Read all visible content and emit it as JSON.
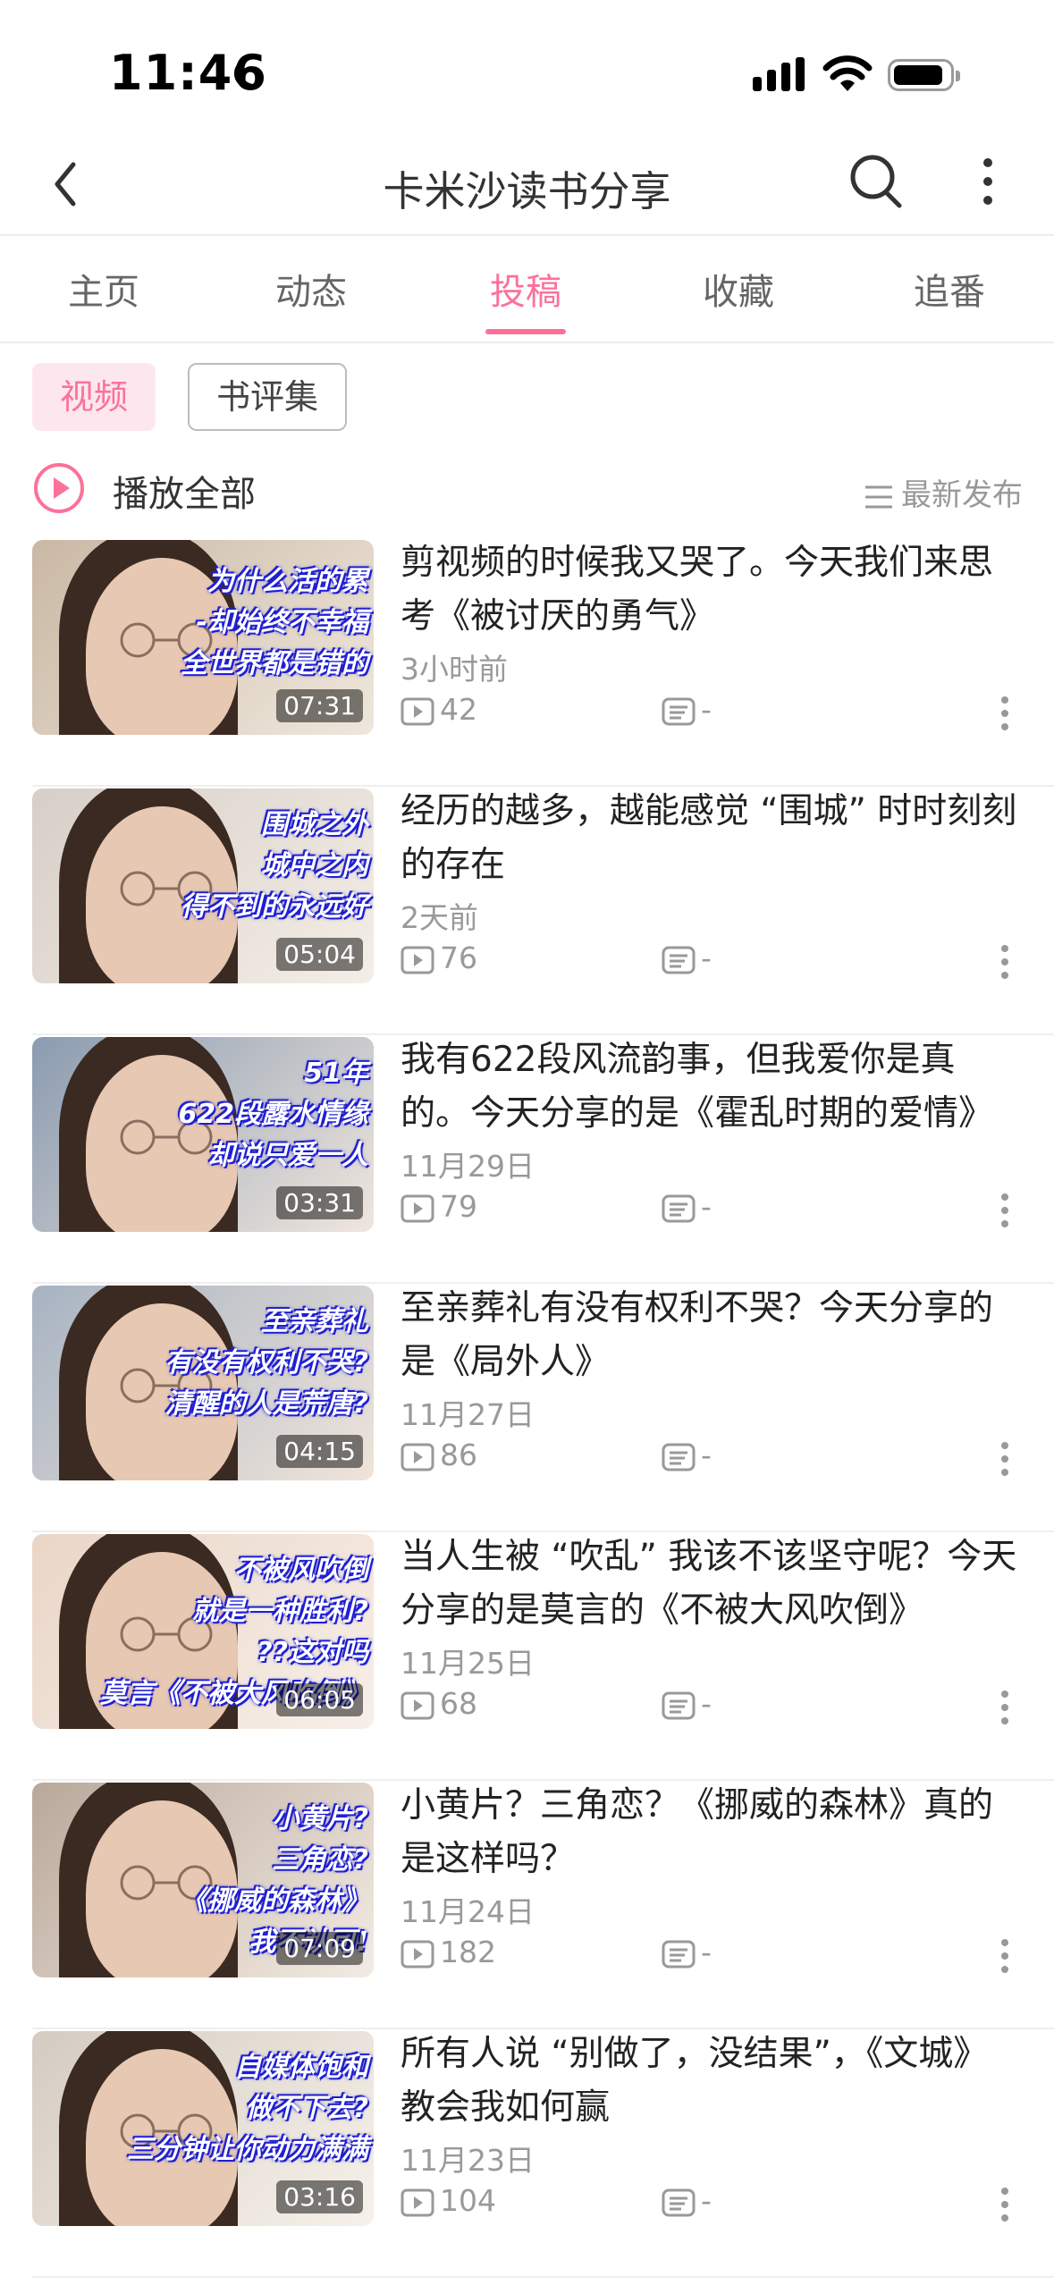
{
  "status_bar": {
    "time": "11:46"
  },
  "nav": {
    "title": "卡米沙读书分享"
  },
  "tabs": [
    {
      "label": "主页"
    },
    {
      "label": "动态"
    },
    {
      "label": "投稿"
    },
    {
      "label": "收藏"
    },
    {
      "label": "追番"
    }
  ],
  "active_tab": "投稿",
  "filters": {
    "video": "视频",
    "book_reviews": "书评集"
  },
  "play_all": {
    "label": "播放全部",
    "sort": "最新发布"
  },
  "videos": [
    {
      "title": "剪视频的时候我又哭了。今天我们来思考《被讨厌的勇气》",
      "date": "3小时前",
      "plays": "42",
      "danmaku": "-",
      "duration": "07:31",
      "thumb_text": [
        "为什么活的累",
        "-却始终不幸福",
        "全世界都是错的"
      ]
    },
    {
      "title": "经历的越多，越能感觉 “围城” 时时刻刻的存在",
      "date": "2天前",
      "plays": "76",
      "danmaku": "-",
      "duration": "05:04",
      "thumb_text": [
        "围城之外",
        "城中之内",
        "得不到的永远好"
      ]
    },
    {
      "title": "我有622段风流韵事，但我爱你是真的。今天分享的是《霍乱时期的爱情》",
      "date": "11月29日",
      "plays": "79",
      "danmaku": "-",
      "duration": "03:31",
      "thumb_text": [
        "51年",
        "622段露水情缘",
        "却说只爱一人"
      ]
    },
    {
      "title": "至亲葬礼有没有权利不哭？今天分享的是《局外人》",
      "date": "11月27日",
      "plays": "86",
      "danmaku": "-",
      "duration": "04:15",
      "thumb_text": [
        "至亲葬礼",
        "有没有权利不哭?",
        "清醒的人是荒唐?"
      ]
    },
    {
      "title": "当人生被 “吹乱” 我该不该坚守呢？今天分享的是莫言的《不被大风吹倒》",
      "date": "11月25日",
      "plays": "68",
      "danmaku": "-",
      "duration": "06:05",
      "thumb_text": [
        "不被风吹倒",
        "就是一种胜利?",
        "??这对吗",
        "莫言《不被大风吹倒》"
      ]
    },
    {
      "title": "小黄片？三角恋？《挪威的森林》真的是这样吗？",
      "date": "11月24日",
      "plays": "182",
      "danmaku": "-",
      "duration": "07:09",
      "thumb_text": [
        "小黄片?",
        "三角恋?",
        "《挪威的森林》",
        "我不认可!"
      ]
    },
    {
      "title": "所有人说 “别做了，没结果”，《文城》教会我如何赢",
      "date": "11月23日",
      "plays": "104",
      "danmaku": "-",
      "duration": "03:16",
      "thumb_text": [
        "自媒体饱和",
        "做不下去?",
        "三分钟让你动力满满"
      ]
    }
  ],
  "colors": {
    "accent": "#fb7299",
    "caption_blue": "#2b2bd8"
  },
  "icons": [
    "moon-icon",
    "signal-icon",
    "wifi-icon",
    "battery-icon",
    "back-icon",
    "search-icon",
    "more-icon",
    "play-circle-icon",
    "sort-icon",
    "play-count-icon",
    "danmaku-icon",
    "item-more-icon"
  ]
}
